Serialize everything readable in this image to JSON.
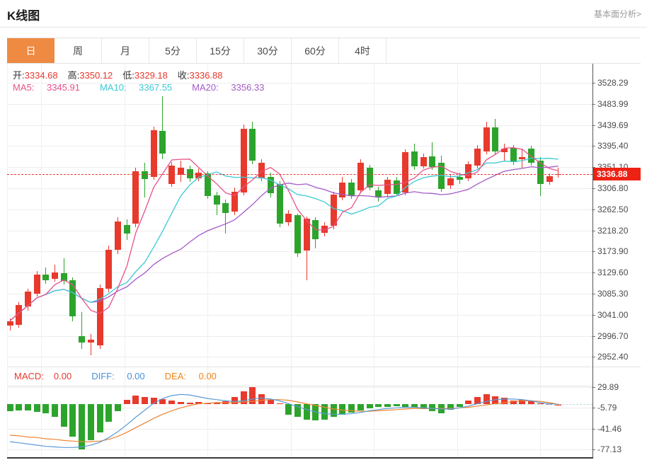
{
  "header": {
    "title": "K线图",
    "analysis_link": "基本面分析>"
  },
  "tabs": {
    "items": [
      "日",
      "周",
      "月",
      "5分",
      "15分",
      "30分",
      "60分",
      "4时"
    ],
    "selected": "日"
  },
  "ohlc": {
    "open_label": "开:",
    "open": "3334.68",
    "high_label": "高:",
    "high": "3350.12",
    "low_label": "低:",
    "low": "3329.18",
    "close_label": "收:",
    "close": "3336.88"
  },
  "ma_legend": {
    "ma5_label": "MA5:",
    "ma5": "3345.91",
    "ma10_label": "MA10:",
    "ma10": "3367.55",
    "ma20_label": "MA20:",
    "ma20": "3356.33"
  },
  "macd_legend": {
    "macd_label": "MACD:",
    "macd": "0.00",
    "diff_label": "DIFF:",
    "diff": "0.00",
    "dea_label": "DEA:",
    "dea": "0.00"
  },
  "price_axis": {
    "ticks": [
      "3528.29",
      "3483.99",
      "3439.69",
      "3395.40",
      "3351.10",
      "3306.80",
      "3262.50",
      "3218.20",
      "3173.90",
      "3129.60",
      "3085.30",
      "3041.00",
      "2996.70",
      "2952.40"
    ],
    "tick_step_value": 44.3,
    "current_price": "3336.88"
  },
  "macd_axis": {
    "ticks": [
      "29.89",
      "-5.79",
      "-41.46",
      "-77.13"
    ],
    "tick_step_value": 35.67
  },
  "colors": {
    "up": "#e8392d",
    "down": "#2ca42c",
    "ma5": "#e8508a",
    "ma10": "#3cc8d4",
    "ma20": "#a45ac8",
    "diff": "#5b9bd5",
    "dea": "#ef8432",
    "tab_selected_bg": "#ef8a43",
    "price_badge_bg": "#ed2215",
    "price_line": "#e8392d"
  },
  "chart_data": {
    "type": "candlestick+macd",
    "title": "K线图",
    "period_selected": "日",
    "legend_note": "red = up candle, green = down candle (Chinese convention)",
    "price_panel": {
      "ylim_top_tick": 3528.29,
      "ylim_bottom_tick": 2952.4,
      "current_price": 3336.88,
      "candles_ohlc_order": [
        "open",
        "high",
        "low",
        "close"
      ],
      "candles": [
        [
          3018,
          3034,
          3008,
          3028
        ],
        [
          3020,
          3068,
          3014,
          3062
        ],
        [
          3058,
          3096,
          3050,
          3090
        ],
        [
          3086,
          3133,
          3080,
          3126
        ],
        [
          3126,
          3141,
          3106,
          3113
        ],
        [
          3116,
          3146,
          3110,
          3130
        ],
        [
          3128,
          3160,
          3104,
          3112
        ],
        [
          3114,
          3119,
          3028,
          3038
        ],
        [
          2996,
          3046,
          2970,
          2982
        ],
        [
          2983,
          3000,
          2956,
          2989
        ],
        [
          2977,
          3104,
          2970,
          3097
        ],
        [
          3095,
          3186,
          3088,
          3178
        ],
        [
          3177,
          3246,
          3168,
          3237
        ],
        [
          3230,
          3241,
          3199,
          3211
        ],
        [
          3232,
          3350,
          3225,
          3343
        ],
        [
          3343,
          3361,
          3288,
          3326
        ],
        [
          3331,
          3436,
          3324,
          3428
        ],
        [
          3427,
          3500,
          3368,
          3380
        ],
        [
          3316,
          3362,
          3310,
          3354
        ],
        [
          3335,
          3365,
          3320,
          3350
        ],
        [
          3347,
          3354,
          3320,
          3328
        ],
        [
          3328,
          3348,
          3322,
          3340
        ],
        [
          3338,
          3342,
          3284,
          3290
        ],
        [
          3292,
          3300,
          3250,
          3272
        ],
        [
          3276,
          3283,
          3212,
          3255
        ],
        [
          3258,
          3308,
          3250,
          3300
        ],
        [
          3298,
          3440,
          3292,
          3431
        ],
        [
          3431,
          3447,
          3358,
          3365
        ],
        [
          3328,
          3368,
          3322,
          3360
        ],
        [
          3331,
          3340,
          3288,
          3296
        ],
        [
          3316,
          3322,
          3225,
          3232
        ],
        [
          3236,
          3260,
          3228,
          3254
        ],
        [
          3250,
          3254,
          3162,
          3170
        ],
        [
          3176,
          3248,
          3114,
          3243
        ],
        [
          3240,
          3246,
          3180,
          3200
        ],
        [
          3213,
          3236,
          3206,
          3228
        ],
        [
          3228,
          3300,
          3220,
          3294
        ],
        [
          3288,
          3330,
          3282,
          3318
        ],
        [
          3319,
          3326,
          3284,
          3290
        ],
        [
          3303,
          3367,
          3296,
          3360
        ],
        [
          3350,
          3356,
          3302,
          3309
        ],
        [
          3303,
          3310,
          3278,
          3287
        ],
        [
          3295,
          3330,
          3288,
          3324
        ],
        [
          3323,
          3330,
          3290,
          3295
        ],
        [
          3298,
          3388,
          3292,
          3382
        ],
        [
          3384,
          3401,
          3346,
          3353
        ],
        [
          3353,
          3380,
          3348,
          3372
        ],
        [
          3374,
          3403,
          3346,
          3352
        ],
        [
          3360,
          3375,
          3300,
          3306
        ],
        [
          3313,
          3336,
          3306,
          3328
        ],
        [
          3331,
          3340,
          3316,
          3324
        ],
        [
          3328,
          3364,
          3322,
          3357
        ],
        [
          3354,
          3398,
          3348,
          3390
        ],
        [
          3384,
          3446,
          3378,
          3434
        ],
        [
          3434,
          3453,
          3378,
          3384
        ],
        [
          3382,
          3401,
          3365,
          3390
        ],
        [
          3391,
          3397,
          3356,
          3362
        ],
        [
          3368,
          3390,
          3350,
          3372
        ],
        [
          3390,
          3396,
          3354,
          3360
        ],
        [
          3365,
          3372,
          3291,
          3316
        ],
        [
          3320,
          3338,
          3314,
          3332
        ],
        [
          3334.68,
          3350.12,
          3329.18,
          3336.88
        ]
      ],
      "ma_windows": [
        5,
        10,
        20
      ]
    },
    "macd_panel": {
      "ylim_top_tick": 29.89,
      "ylim_bottom_tick": -77.13,
      "histogram": [
        -12,
        -10,
        -11,
        -13,
        -15,
        -22,
        -38,
        -56,
        -77,
        -62,
        -48,
        -30,
        -12,
        8,
        15,
        13,
        11,
        9,
        6,
        4,
        3,
        4,
        2,
        3,
        5,
        12,
        22,
        30,
        18,
        8,
        2,
        -18,
        -22,
        -26,
        -28,
        -26,
        -22,
        -18,
        -14,
        -10,
        -7,
        -5,
        -4,
        -3,
        -4,
        -6,
        -8,
        -12,
        -15,
        -9,
        -4,
        6,
        12,
        17,
        14,
        11,
        7,
        8,
        5,
        2,
        1,
        0
      ],
      "diff": [
        -64,
        -66,
        -68,
        -70,
        -72,
        -73,
        -74,
        -74,
        -73,
        -70,
        -65,
        -57,
        -47,
        -35,
        -22,
        -10,
        2,
        10,
        15,
        17,
        16,
        13,
        10,
        8,
        6,
        5,
        6,
        9,
        11,
        9,
        6,
        1,
        -4,
        -9,
        -13,
        -16,
        -17,
        -17,
        -16,
        -14,
        -11,
        -9,
        -7,
        -6,
        -5,
        -5,
        -6,
        -7,
        -8,
        -8,
        -6,
        -3,
        1,
        5,
        8,
        9,
        9,
        8,
        6,
        3,
        1,
        0
      ],
      "dea": [
        -53,
        -54,
        -56,
        -57,
        -59,
        -60,
        -62,
        -63,
        -64,
        -64,
        -63,
        -60,
        -55,
        -48,
        -40,
        -32,
        -24,
        -17,
        -11,
        -6,
        -2,
        1,
        2,
        3,
        3,
        3,
        4,
        5,
        7,
        8,
        8,
        7,
        4,
        1,
        -2,
        -5,
        -8,
        -10,
        -11,
        -12,
        -12,
        -11,
        -10,
        -9,
        -8,
        -7,
        -7,
        -7,
        -7,
        -7,
        -6,
        -5,
        -3,
        -1,
        1,
        3,
        5,
        6,
        6,
        5,
        3,
        0
      ]
    }
  }
}
